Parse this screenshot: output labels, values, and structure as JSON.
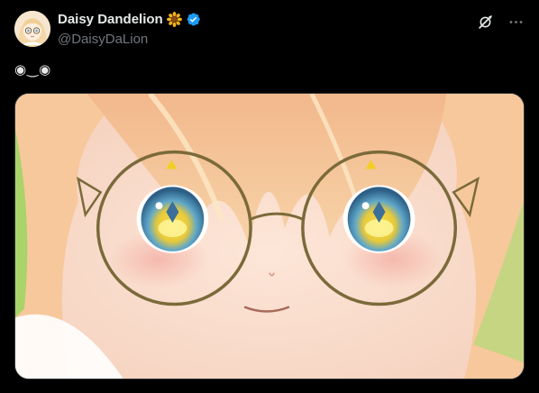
{
  "author": {
    "display_name": "Daisy Dandelion",
    "handle": "@DaisyDaLion",
    "name_emoji_icon": "sunflower-emoji-icon",
    "verified_icon": "verified-badge-icon",
    "colors": {
      "verified": "#1d9bf0",
      "handle": "#71767b"
    }
  },
  "actions": {
    "grok_icon": "grok-icon",
    "more_icon": "more-options-icon"
  },
  "tweet": {
    "text": "◉‿◉"
  },
  "media": {
    "type": "image",
    "subject": "anime-girl-closeup-with-round-glasses"
  }
}
